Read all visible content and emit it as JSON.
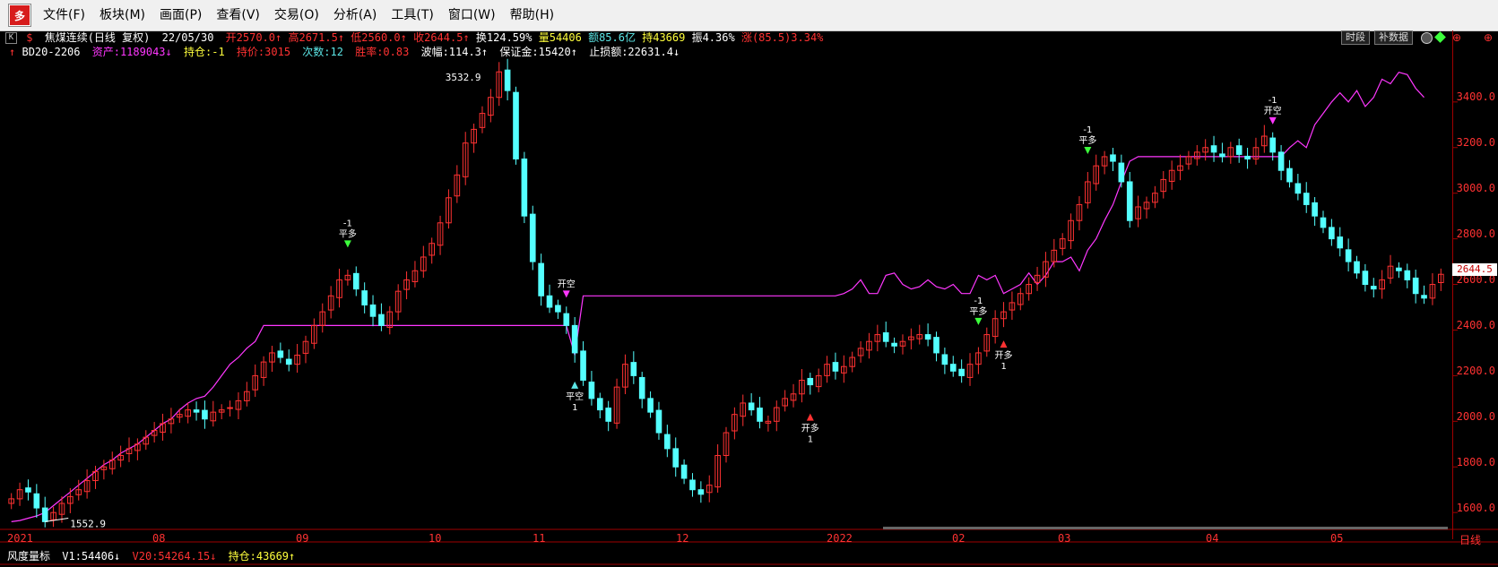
{
  "menubar": {
    "app_icon": "多",
    "items": [
      "文件(F)",
      "板块(M)",
      "画面(P)",
      "查看(V)",
      "交易(O)",
      "分析(A)",
      "工具(T)",
      "窗口(W)",
      "帮助(H)"
    ]
  },
  "info_line1": {
    "k_label": "K",
    "title": "焦煤连续(日线 复权)",
    "date": "22/05/30",
    "open": "开2570.0↑",
    "high": "高2671.5↑",
    "low": "低2560.0↑",
    "close": "收2644.5↑",
    "turnover": "换124.59%",
    "volume": "量54406",
    "amount": "额85.6亿",
    "position": "持43669",
    "amplitude": "振4.36%",
    "change": "涨(85.5)3.34%"
  },
  "info_line2": {
    "strategy": "BD20-2206",
    "assets": "资产:1189043↓",
    "holding": "持仓:-1",
    "hold_price": "持价:3015",
    "count": "次数:12",
    "winrate": "胜率:0.83",
    "amplitude": "波幅:114.3↑",
    "margin": "保证金:15420↑",
    "stoploss": "止损额:22631.4↓"
  },
  "top_buttons": {
    "period": "时段",
    "fill": "补数据"
  },
  "y_axis": {
    "ticks": [
      "3400.0",
      "3200.0",
      "3000.0",
      "2800.0",
      "2600.0",
      "2400.0",
      "2200.0",
      "2000.0",
      "1800.0",
      "1600.0"
    ],
    "current_price": "2644.5"
  },
  "x_axis": {
    "ticks": [
      "2021",
      "08",
      "09",
      "10",
      "11",
      "12",
      "2022",
      "02",
      "03",
      "04",
      "05"
    ],
    "period_label": "日线"
  },
  "annotations": {
    "high_label": "3532.9",
    "low_label": "1552.9"
  },
  "signals": [
    {
      "top": "-1",
      "main": "平多"
    },
    {
      "top": "",
      "main": "开空"
    },
    {
      "top": "",
      "main": "平空"
    },
    {
      "top": "",
      "main": "开多"
    },
    {
      "top": "-1",
      "main": "平多"
    },
    {
      "top": "",
      "main": "开多"
    },
    {
      "top": "-1",
      "main": "平多"
    },
    {
      "top": "-1",
      "main": "开空"
    }
  ],
  "signal_qty": "1",
  "bottom": {
    "indicator": "风度量标",
    "v1": "V1:54406↓",
    "v20": "V20:54264.15↓",
    "pos": "持仓:43669↑"
  },
  "colors": {
    "up": "#ff3232",
    "down": "#54ffff",
    "equity": "#ff37ff",
    "axis": "#a00000"
  },
  "chart_data": {
    "type": "candlestick",
    "title": "焦煤连续(日线 复权)",
    "ylim": [
      1530,
      3580
    ],
    "x_ticks": [
      "2021",
      "08",
      "09",
      "10",
      "11",
      "12",
      "2022",
      "02",
      "03",
      "04",
      "05"
    ],
    "close_series": [
      1660,
      1700,
      1690,
      1620,
      1560,
      1600,
      1640,
      1670,
      1700,
      1740,
      1780,
      1800,
      1830,
      1850,
      1880,
      1900,
      1930,
      1960,
      1990,
      2010,
      2030,
      2050,
      2040,
      2010,
      2040,
      2050,
      2060,
      2090,
      2130,
      2200,
      2260,
      2300,
      2280,
      2250,
      2290,
      2350,
      2420,
      2480,
      2550,
      2620,
      2640,
      2580,
      2510,
      2460,
      2420,
      2480,
      2570,
      2620,
      2660,
      2720,
      2780,
      2870,
      2980,
      3080,
      3220,
      3280,
      3350,
      3420,
      3532,
      3450,
      3150,
      2900,
      2700,
      2550,
      2500,
      2480,
      2420,
      2300,
      2180,
      2100,
      2050,
      2000,
      2150,
      2250,
      2200,
      2100,
      2040,
      1950,
      1880,
      1800,
      1750,
      1700,
      1680,
      1720,
      1850,
      1950,
      2030,
      2080,
      2050,
      2000,
      2000,
      2060,
      2100,
      2120,
      2180,
      2160,
      2200,
      2250,
      2220,
      2240,
      2280,
      2320,
      2350,
      2380,
      2350,
      2330,
      2350,
      2370,
      2380,
      2360,
      2300,
      2250,
      2220,
      2200,
      2250,
      2300,
      2380,
      2450,
      2480,
      2520,
      2560,
      2600,
      2640,
      2700,
      2750,
      2800,
      2880,
      2950,
      3050,
      3120,
      3160,
      3140,
      3050,
      2880,
      2940,
      2960,
      3000,
      3060,
      3100,
      3120,
      3160,
      3180,
      3200,
      3180,
      3160,
      3200,
      3170,
      3150,
      3200,
      3250,
      3180,
      3100,
      3050,
      3000,
      2950,
      2900,
      2850,
      2800,
      2760,
      2700,
      2650,
      2600,
      2580,
      2620,
      2680,
      2660,
      2620,
      2560,
      2540,
      2600,
      2644.5
    ],
    "equity_series": [
      1560,
      1565,
      1575,
      1585,
      1600,
      1630,
      1660,
      1690,
      1720,
      1750,
      1780,
      1810,
      1830,
      1860,
      1880,
      1900,
      1930,
      1960,
      1990,
      2010,
      2050,
      2080,
      2100,
      2110,
      2150,
      2200,
      2250,
      2280,
      2320,
      2350,
      2420,
      2420,
      2420,
      2420,
      2420,
      2420,
      2420,
      2420,
      2420,
      2420,
      2420,
      2420,
      2420,
      2420,
      2420,
      2420,
      2420,
      2420,
      2420,
      2420,
      2420,
      2420,
      2420,
      2420,
      2420,
      2420,
      2420,
      2420,
      2420,
      2420,
      2420,
      2420,
      2420,
      2420,
      2420,
      2420,
      2420,
      2290,
      2550,
      2550,
      2550,
      2550,
      2550,
      2550,
      2550,
      2550,
      2550,
      2550,
      2550,
      2550,
      2550,
      2550,
      2550,
      2550,
      2550,
      2550,
      2550,
      2550,
      2550,
      2550,
      2550,
      2550,
      2550,
      2550,
      2550,
      2550,
      2550,
      2550,
      2550,
      2560,
      2580,
      2620,
      2560,
      2560,
      2640,
      2650,
      2600,
      2580,
      2590,
      2620,
      2590,
      2580,
      2600,
      2560,
      2560,
      2640,
      2620,
      2640,
      2560,
      2580,
      2600,
      2650,
      2600,
      2640,
      2700,
      2700,
      2720,
      2660,
      2750,
      2800,
      2880,
      2950,
      3050,
      3140,
      3160,
      3160,
      3160,
      3160,
      3160,
      3160,
      3160,
      3160,
      3160,
      3160,
      3160,
      3160,
      3160,
      3160,
      3160,
      3160,
      3160,
      3160,
      3200,
      3230,
      3200,
      3300,
      3350,
      3400,
      3440,
      3400,
      3450,
      3380,
      3420,
      3500,
      3480,
      3530,
      3520,
      3460,
      3420
    ]
  }
}
